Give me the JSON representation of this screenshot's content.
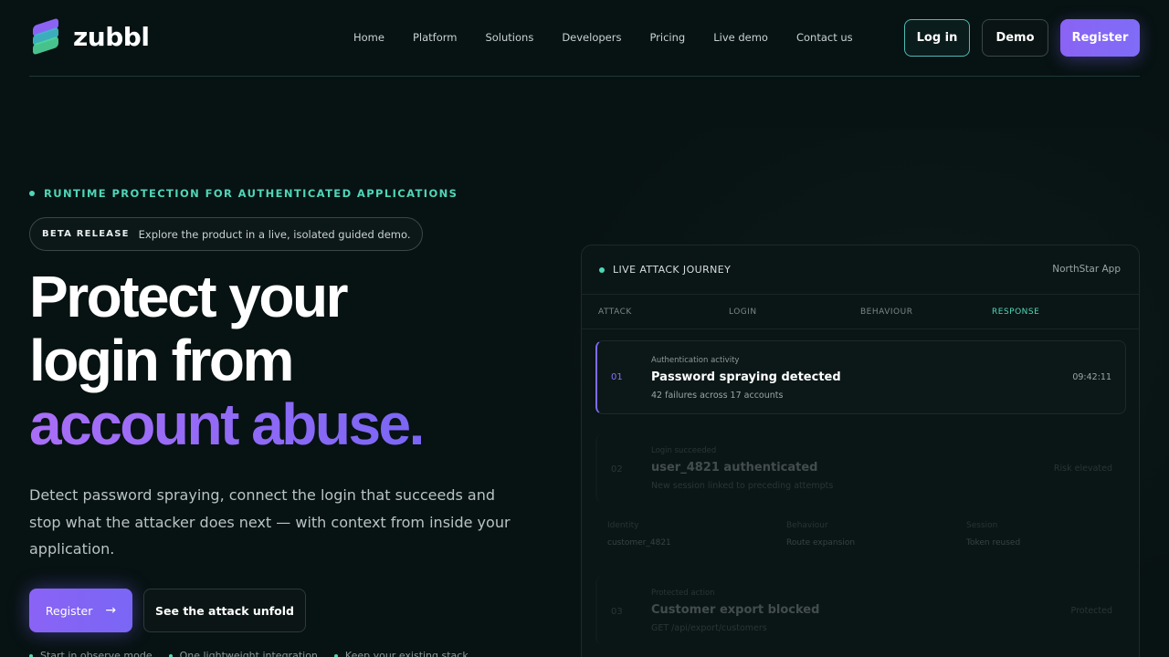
{
  "brand": {
    "name": "zubbl"
  },
  "nav": {
    "items": [
      "Home",
      "Platform",
      "Solutions",
      "Developers",
      "Pricing",
      "Live demo",
      "Contact us"
    ],
    "login": "Log in",
    "demo": "Demo",
    "register": "Register"
  },
  "hero": {
    "eyebrow": "RUNTIME PROTECTION FOR AUTHENTICATED APPLICATIONS",
    "pill_tag": "BETA RELEASE",
    "pill_text": "Explore the product in a live, isolated guided demo.",
    "headline_line1": "Protect your",
    "headline_line2": "login from",
    "headline_line3": "account abuse.",
    "subtitle": "Detect password spraying, connect the login that succeeds and stop what the attacker does next — with context from inside your application.",
    "cta_primary": "Register",
    "cta_secondary": "See the attack unfold",
    "bullets": [
      "Start in observe mode",
      "One lightweight integration",
      "Keep your existing stack"
    ]
  },
  "panel": {
    "title": "LIVE ATTACK JOURNEY",
    "app": "NorthStar App",
    "tabs": [
      "ATTACK",
      "LOGIN",
      "BEHAVIOUR",
      "RESPONSE"
    ],
    "active_tab": "RESPONSE",
    "events": [
      {
        "num": "01",
        "category": "Authentication activity",
        "title": "Password spraying detected",
        "desc": "42 failures across 17 accounts",
        "right": "09:42:11"
      },
      {
        "num": "02",
        "category": "Login succeeded",
        "title": "user_4821 authenticated",
        "desc": "New session linked to preceding attempts",
        "right": "Risk elevated"
      },
      {
        "num": "03",
        "category": "Protected action",
        "title": "Customer export blocked",
        "desc": "GET /api/export/customers",
        "right": "Protected"
      }
    ],
    "meta": [
      {
        "label": "Identity",
        "value": "customer_4821"
      },
      {
        "label": "Behaviour",
        "value": "Route expansion"
      },
      {
        "label": "Session",
        "value": "Token reused"
      }
    ]
  },
  "colors": {
    "accent_purple": "#8a63f5",
    "accent_teal": "#4fd6b8",
    "background": "#071212"
  }
}
